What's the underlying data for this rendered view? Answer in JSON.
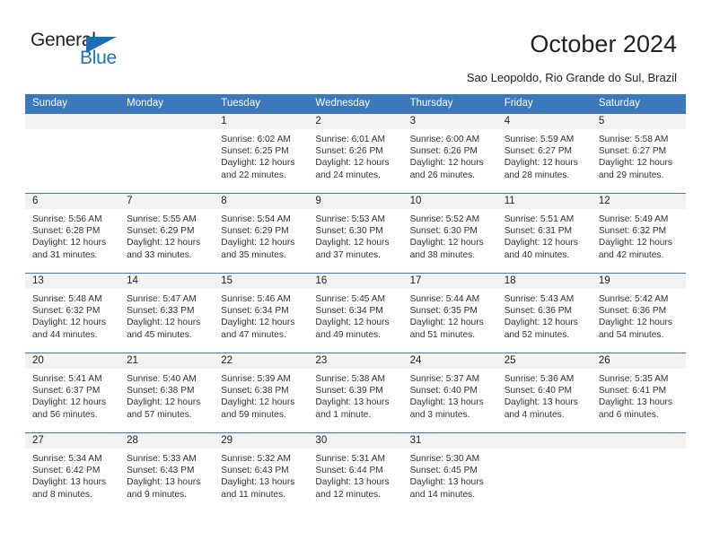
{
  "brand": {
    "name_part1": "General",
    "name_part2": "Blue",
    "triangle_color": "#1b6fb5",
    "blue_text_color": "#1b75bc"
  },
  "header": {
    "title": "October 2024",
    "subtitle": "Sao Leopoldo, Rio Grande do Sul, Brazil"
  },
  "colors": {
    "header_blue": "#3c78bc",
    "daynum_band": "#f2f2f2",
    "text": "#222222"
  },
  "weekdays": [
    "Sunday",
    "Monday",
    "Tuesday",
    "Wednesday",
    "Thursday",
    "Friday",
    "Saturday"
  ],
  "weeks": [
    [
      {
        "day": "",
        "sunrise": "",
        "sunset": "",
        "daylight": "",
        "empty": true
      },
      {
        "day": "",
        "sunrise": "",
        "sunset": "",
        "daylight": "",
        "empty": true
      },
      {
        "day": "1",
        "sunrise": "Sunrise: 6:02 AM",
        "sunset": "Sunset: 6:25 PM",
        "daylight": "Daylight: 12 hours and 22 minutes."
      },
      {
        "day": "2",
        "sunrise": "Sunrise: 6:01 AM",
        "sunset": "Sunset: 6:26 PM",
        "daylight": "Daylight: 12 hours and 24 minutes."
      },
      {
        "day": "3",
        "sunrise": "Sunrise: 6:00 AM",
        "sunset": "Sunset: 6:26 PM",
        "daylight": "Daylight: 12 hours and 26 minutes."
      },
      {
        "day": "4",
        "sunrise": "Sunrise: 5:59 AM",
        "sunset": "Sunset: 6:27 PM",
        "daylight": "Daylight: 12 hours and 28 minutes."
      },
      {
        "day": "5",
        "sunrise": "Sunrise: 5:58 AM",
        "sunset": "Sunset: 6:27 PM",
        "daylight": "Daylight: 12 hours and 29 minutes."
      }
    ],
    [
      {
        "day": "6",
        "sunrise": "Sunrise: 5:56 AM",
        "sunset": "Sunset: 6:28 PM",
        "daylight": "Daylight: 12 hours and 31 minutes."
      },
      {
        "day": "7",
        "sunrise": "Sunrise: 5:55 AM",
        "sunset": "Sunset: 6:29 PM",
        "daylight": "Daylight: 12 hours and 33 minutes."
      },
      {
        "day": "8",
        "sunrise": "Sunrise: 5:54 AM",
        "sunset": "Sunset: 6:29 PM",
        "daylight": "Daylight: 12 hours and 35 minutes."
      },
      {
        "day": "9",
        "sunrise": "Sunrise: 5:53 AM",
        "sunset": "Sunset: 6:30 PM",
        "daylight": "Daylight: 12 hours and 37 minutes."
      },
      {
        "day": "10",
        "sunrise": "Sunrise: 5:52 AM",
        "sunset": "Sunset: 6:30 PM",
        "daylight": "Daylight: 12 hours and 38 minutes."
      },
      {
        "day": "11",
        "sunrise": "Sunrise: 5:51 AM",
        "sunset": "Sunset: 6:31 PM",
        "daylight": "Daylight: 12 hours and 40 minutes."
      },
      {
        "day": "12",
        "sunrise": "Sunrise: 5:49 AM",
        "sunset": "Sunset: 6:32 PM",
        "daylight": "Daylight: 12 hours and 42 minutes."
      }
    ],
    [
      {
        "day": "13",
        "sunrise": "Sunrise: 5:48 AM",
        "sunset": "Sunset: 6:32 PM",
        "daylight": "Daylight: 12 hours and 44 minutes."
      },
      {
        "day": "14",
        "sunrise": "Sunrise: 5:47 AM",
        "sunset": "Sunset: 6:33 PM",
        "daylight": "Daylight: 12 hours and 45 minutes."
      },
      {
        "day": "15",
        "sunrise": "Sunrise: 5:46 AM",
        "sunset": "Sunset: 6:34 PM",
        "daylight": "Daylight: 12 hours and 47 minutes."
      },
      {
        "day": "16",
        "sunrise": "Sunrise: 5:45 AM",
        "sunset": "Sunset: 6:34 PM",
        "daylight": "Daylight: 12 hours and 49 minutes."
      },
      {
        "day": "17",
        "sunrise": "Sunrise: 5:44 AM",
        "sunset": "Sunset: 6:35 PM",
        "daylight": "Daylight: 12 hours and 51 minutes."
      },
      {
        "day": "18",
        "sunrise": "Sunrise: 5:43 AM",
        "sunset": "Sunset: 6:36 PM",
        "daylight": "Daylight: 12 hours and 52 minutes."
      },
      {
        "day": "19",
        "sunrise": "Sunrise: 5:42 AM",
        "sunset": "Sunset: 6:36 PM",
        "daylight": "Daylight: 12 hours and 54 minutes."
      }
    ],
    [
      {
        "day": "20",
        "sunrise": "Sunrise: 5:41 AM",
        "sunset": "Sunset: 6:37 PM",
        "daylight": "Daylight: 12 hours and 56 minutes."
      },
      {
        "day": "21",
        "sunrise": "Sunrise: 5:40 AM",
        "sunset": "Sunset: 6:38 PM",
        "daylight": "Daylight: 12 hours and 57 minutes."
      },
      {
        "day": "22",
        "sunrise": "Sunrise: 5:39 AM",
        "sunset": "Sunset: 6:38 PM",
        "daylight": "Daylight: 12 hours and 59 minutes."
      },
      {
        "day": "23",
        "sunrise": "Sunrise: 5:38 AM",
        "sunset": "Sunset: 6:39 PM",
        "daylight": "Daylight: 13 hours and 1 minute."
      },
      {
        "day": "24",
        "sunrise": "Sunrise: 5:37 AM",
        "sunset": "Sunset: 6:40 PM",
        "daylight": "Daylight: 13 hours and 3 minutes."
      },
      {
        "day": "25",
        "sunrise": "Sunrise: 5:36 AM",
        "sunset": "Sunset: 6:40 PM",
        "daylight": "Daylight: 13 hours and 4 minutes."
      },
      {
        "day": "26",
        "sunrise": "Sunrise: 5:35 AM",
        "sunset": "Sunset: 6:41 PM",
        "daylight": "Daylight: 13 hours and 6 minutes."
      }
    ],
    [
      {
        "day": "27",
        "sunrise": "Sunrise: 5:34 AM",
        "sunset": "Sunset: 6:42 PM",
        "daylight": "Daylight: 13 hours and 8 minutes."
      },
      {
        "day": "28",
        "sunrise": "Sunrise: 5:33 AM",
        "sunset": "Sunset: 6:43 PM",
        "daylight": "Daylight: 13 hours and 9 minutes."
      },
      {
        "day": "29",
        "sunrise": "Sunrise: 5:32 AM",
        "sunset": "Sunset: 6:43 PM",
        "daylight": "Daylight: 13 hours and 11 minutes."
      },
      {
        "day": "30",
        "sunrise": "Sunrise: 5:31 AM",
        "sunset": "Sunset: 6:44 PM",
        "daylight": "Daylight: 13 hours and 12 minutes."
      },
      {
        "day": "31",
        "sunrise": "Sunrise: 5:30 AM",
        "sunset": "Sunset: 6:45 PM",
        "daylight": "Daylight: 13 hours and 14 minutes."
      },
      {
        "day": "",
        "sunrise": "",
        "sunset": "",
        "daylight": "",
        "empty": true
      },
      {
        "day": "",
        "sunrise": "",
        "sunset": "",
        "daylight": "",
        "empty": true
      }
    ]
  ]
}
